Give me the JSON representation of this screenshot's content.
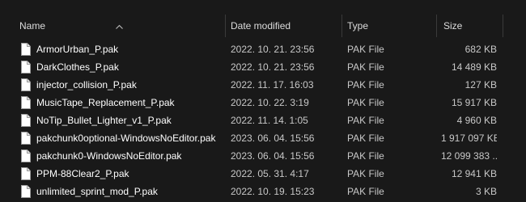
{
  "columns": {
    "name": "Name",
    "date": "Date modified",
    "type": "Type",
    "size": "Size"
  },
  "sort": {
    "column": "name",
    "direction": "ascending",
    "icon": "chevron-up-icon"
  },
  "files": [
    {
      "name": "ArmorUrban_P.pak",
      "date": "2022. 10. 21. 23:56",
      "type": "PAK File",
      "size": "682 KB"
    },
    {
      "name": "DarkClothes_P.pak",
      "date": "2022. 10. 21. 23:56",
      "type": "PAK File",
      "size": "14 489 KB"
    },
    {
      "name": "injector_collision_P.pak",
      "date": "2022. 11. 17. 16:03",
      "type": "PAK File",
      "size": "127 KB"
    },
    {
      "name": "MusicTape_Replacement_P.pak",
      "date": "2022. 10. 22. 3:19",
      "type": "PAK File",
      "size": "15 917 KB"
    },
    {
      "name": "NoTip_Bullet_Lighter_v1_P.pak",
      "date": "2022. 11. 14. 1:05",
      "type": "PAK File",
      "size": "4 960 KB"
    },
    {
      "name": "pakchunk0optional-WindowsNoEditor.pak",
      "date": "2023. 06. 04. 15:56",
      "type": "PAK File",
      "size": "1 917 097 KB"
    },
    {
      "name": "pakchunk0-WindowsNoEditor.pak",
      "date": "2023. 06. 04. 15:56",
      "type": "PAK File",
      "size": "12 099 383 ..."
    },
    {
      "name": "PPM-88Clear2_P.pak",
      "date": "2022. 05. 31. 4:17",
      "type": "PAK File",
      "size": "12 941 KB"
    },
    {
      "name": "unlimited_sprint_mod_P.pak",
      "date": "2022. 10. 19. 15:23",
      "type": "PAK File",
      "size": "3 KB"
    }
  ],
  "colors": {
    "background": "#191919",
    "header_text": "#dcdcdc",
    "name_text": "#ffffff",
    "detail_text": "#c8c8c8",
    "separator": "#3a3a3a"
  },
  "icons": {
    "file": "file-icon"
  }
}
